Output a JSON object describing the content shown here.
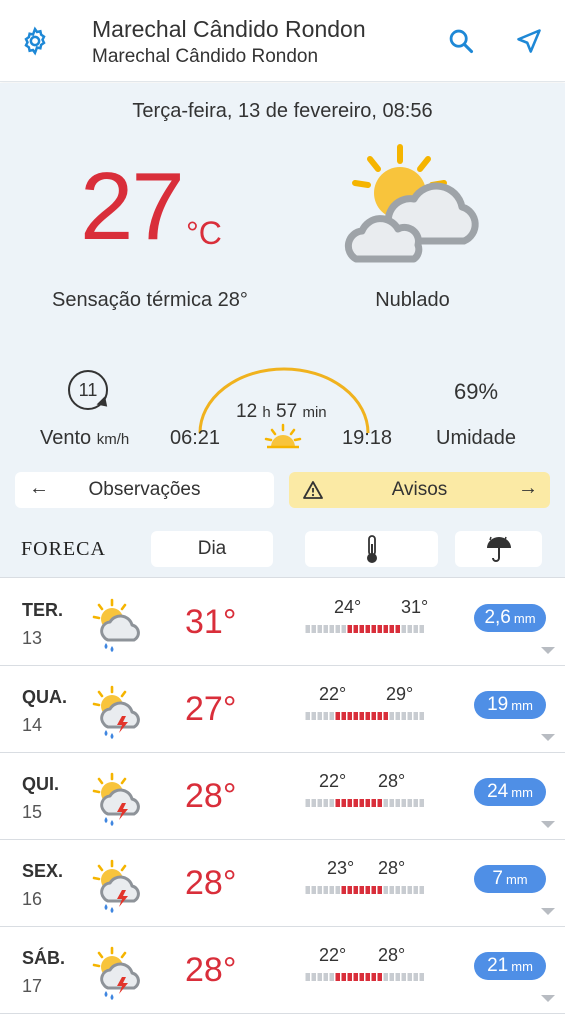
{
  "header": {
    "title": "Marechal Cândido Rondon",
    "subtitle": "Marechal Cândido Rondon",
    "icons": [
      "gear-icon",
      "search-icon",
      "navigation-arrow-icon"
    ]
  },
  "current": {
    "datetime": "Terça-feira, 13 de fevereiro, 08:56",
    "temperature": "27",
    "temperature_unit": "°C",
    "feels_like": "Sensação térmica 28°",
    "condition": "Nublado",
    "condition_icon": "partly-cloudy-icon",
    "wind_speed": "11",
    "wind_label": "Vento",
    "wind_unit": "km/h",
    "day_length": "12",
    "day_length_h": "h",
    "day_length_min": "57",
    "day_length_min_unit": "min",
    "sunrise": "06:21",
    "sunset": "19:18",
    "humidity": "69%",
    "humidity_label": "Umidade"
  },
  "buttons": {
    "observations": "Observações",
    "warnings": "Avisos"
  },
  "forecast_bar": {
    "brand": "FORECA",
    "tab_day": "Dia",
    "tab_temperature_icon": "thermometer-icon",
    "tab_precip_icon": "umbrella-rain-icon"
  },
  "days": [
    {
      "name": "TER.",
      "date": "13",
      "icon": "sun-cloud-rain-icon",
      "max": "31°",
      "low": "24°",
      "high": "31°",
      "low_val": 24,
      "high_val": 31,
      "rain": "2,6",
      "rain_unit": "mm"
    },
    {
      "name": "QUA.",
      "date": "14",
      "icon": "sun-cloud-thunder-rain-icon",
      "max": "27°",
      "low": "22°",
      "high": "29°",
      "low_val": 22,
      "high_val": 29,
      "rain": "19",
      "rain_unit": "mm"
    },
    {
      "name": "QUI.",
      "date": "15",
      "icon": "sun-cloud-thunder-rain-icon",
      "max": "28°",
      "low": "22°",
      "high": "28°",
      "low_val": 22,
      "high_val": 28,
      "rain": "24",
      "rain_unit": "mm"
    },
    {
      "name": "SEX.",
      "date": "16",
      "icon": "sun-cloud-thunder-rain-icon",
      "max": "28°",
      "low": "23°",
      "high": "28°",
      "low_val": 23,
      "high_val": 28,
      "rain": "7",
      "rain_unit": "mm"
    },
    {
      "name": "SÁB.",
      "date": "17",
      "icon": "sun-cloud-thunder-rain-icon",
      "max": "28°",
      "low": "22°",
      "high": "28°",
      "low_val": 22,
      "high_val": 28,
      "rain": "21",
      "rain_unit": "mm"
    }
  ],
  "colors": {
    "accent_blue": "#1e88d6",
    "temp_red": "#d92e3a",
    "rain_pill": "#4f8fe6",
    "panel_bg": "#edf3f8",
    "warning_bg": "#fbeaa5"
  }
}
